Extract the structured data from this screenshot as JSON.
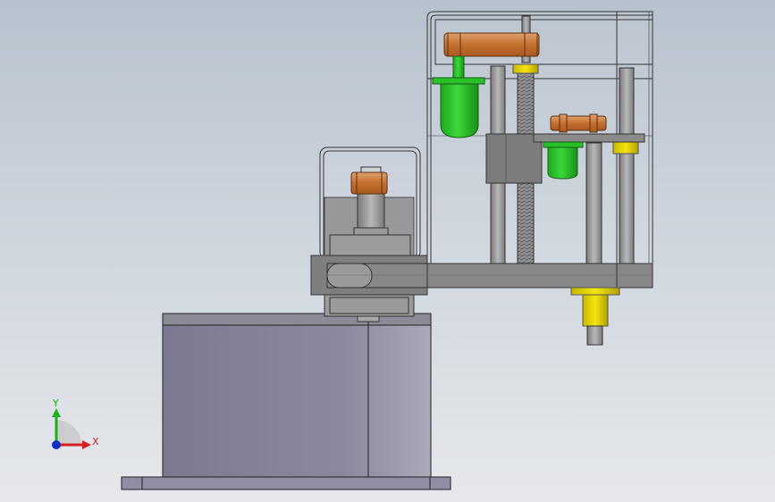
{
  "viewport": {
    "background_top": "#b9c3cf",
    "background_bottom": "#e6e9ec"
  },
  "triad": {
    "x_label": "X",
    "y_label": "Y",
    "x_color": "#d42020",
    "y_color": "#20b020",
    "z_color": "#1030c0"
  },
  "model": {
    "colors": {
      "base_housing": "#7c7a92",
      "base_housing_shade": "#9a98ac",
      "steel_gray": "#8a8a8a",
      "arm_gray": "#858585",
      "copper_pulley": "#c8773a",
      "green_motor": "#2cc02c",
      "yellow_collar": "#e8d400",
      "transparent_cover_edge": "#4a4a4a"
    },
    "components": [
      "base-housing",
      "base-flange",
      "joint1-cover",
      "joint1-pulley",
      "arm-link",
      "arm2-cover",
      "belt-pulley-upper",
      "motor-upper",
      "ball-screw",
      "guide-rods",
      "carriage-block",
      "belt-pulley-lower",
      "motor-lower",
      "z-shaft",
      "z-shaft-collar"
    ]
  }
}
